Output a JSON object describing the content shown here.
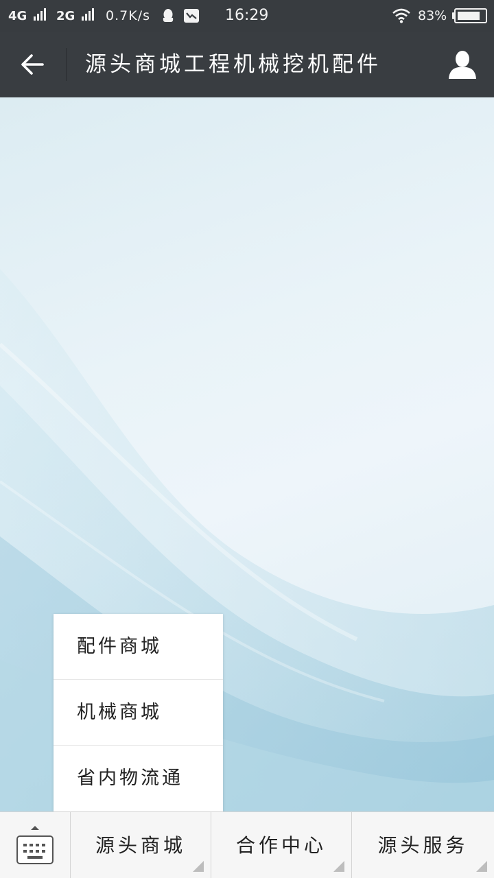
{
  "status_bar": {
    "network1": "4G",
    "network2": "2G",
    "speed": "0.7K/s",
    "time": "16:29",
    "battery_text": "83%",
    "battery_level": 0.83,
    "icons": [
      "signal-icon",
      "qq-icon",
      "message-icon",
      "wifi-icon",
      "battery-icon"
    ]
  },
  "header": {
    "title": "源头商城工程机械挖机配件",
    "back_icon": "arrow-left-icon",
    "profile_icon": "user-icon"
  },
  "popup_menu": {
    "items": [
      {
        "label": "配件商城"
      },
      {
        "label": "机械商城"
      },
      {
        "label": "省内物流通"
      }
    ]
  },
  "bottom_bar": {
    "keyboard_icon": "keyboard-icon",
    "tabs": [
      {
        "label": "源头商城"
      },
      {
        "label": "合作中心"
      },
      {
        "label": "源头服务"
      }
    ]
  },
  "colors": {
    "status_bar_bg": "#383c40",
    "header_bg": "#393d41",
    "content_bg": "#e8f2f6",
    "wave_blue": "#7fb8d0"
  }
}
